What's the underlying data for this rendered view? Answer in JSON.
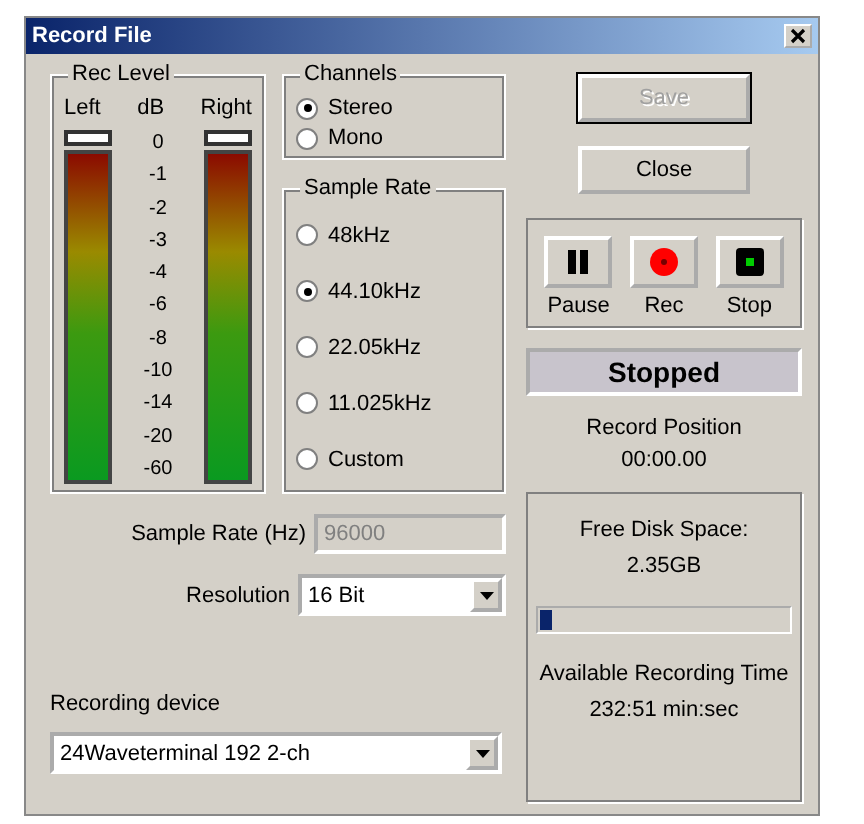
{
  "window": {
    "title": "Record File"
  },
  "rec_level": {
    "title": "Rec Level",
    "left_label": "Left",
    "unit": "dB",
    "right_label": "Right",
    "scale": [
      "0",
      "-1",
      "-2",
      "-3",
      "-4",
      "-6",
      "-8",
      "-10",
      "-14",
      "-20",
      "-60"
    ],
    "meters": [
      {
        "level": 1
      },
      {
        "level": 1
      }
    ]
  },
  "channels": {
    "title": "Channels",
    "options": [
      {
        "label": "Stereo",
        "selected": true
      },
      {
        "label": "Mono",
        "selected": false
      }
    ]
  },
  "sample_rate": {
    "title": "Sample Rate",
    "options": [
      {
        "label": "48kHz",
        "selected": false
      },
      {
        "label": "44.10kHz",
        "selected": true
      },
      {
        "label": "22.05kHz",
        "selected": false
      },
      {
        "label": "11.025kHz",
        "selected": false
      },
      {
        "label": "Custom",
        "selected": false
      }
    ]
  },
  "sample_rate_hz": {
    "label": "Sample Rate (Hz)",
    "value": "96000",
    "disabled": true
  },
  "resolution": {
    "label": "Resolution",
    "value": "16 Bit"
  },
  "recording_device": {
    "label": "Recording device",
    "value": "24Waveterminal 192 2-ch"
  },
  "buttons": [
    {
      "label": "Save",
      "disabled": true
    },
    {
      "label": "Close",
      "disabled": false
    }
  ],
  "transport": [
    {
      "kind": "pause",
      "label": "Pause"
    },
    {
      "kind": "rec",
      "label": "Rec"
    },
    {
      "kind": "stop",
      "label": "Stop"
    }
  ],
  "status": "Stopped",
  "record_position": {
    "label": "Record Position",
    "value": "00:00.00"
  },
  "disk": {
    "label": "Free Disk Space:",
    "value": "2.35GB",
    "level": 0.06,
    "time_label": "Available Recording Time",
    "time_value": "232:51 min:sec"
  }
}
